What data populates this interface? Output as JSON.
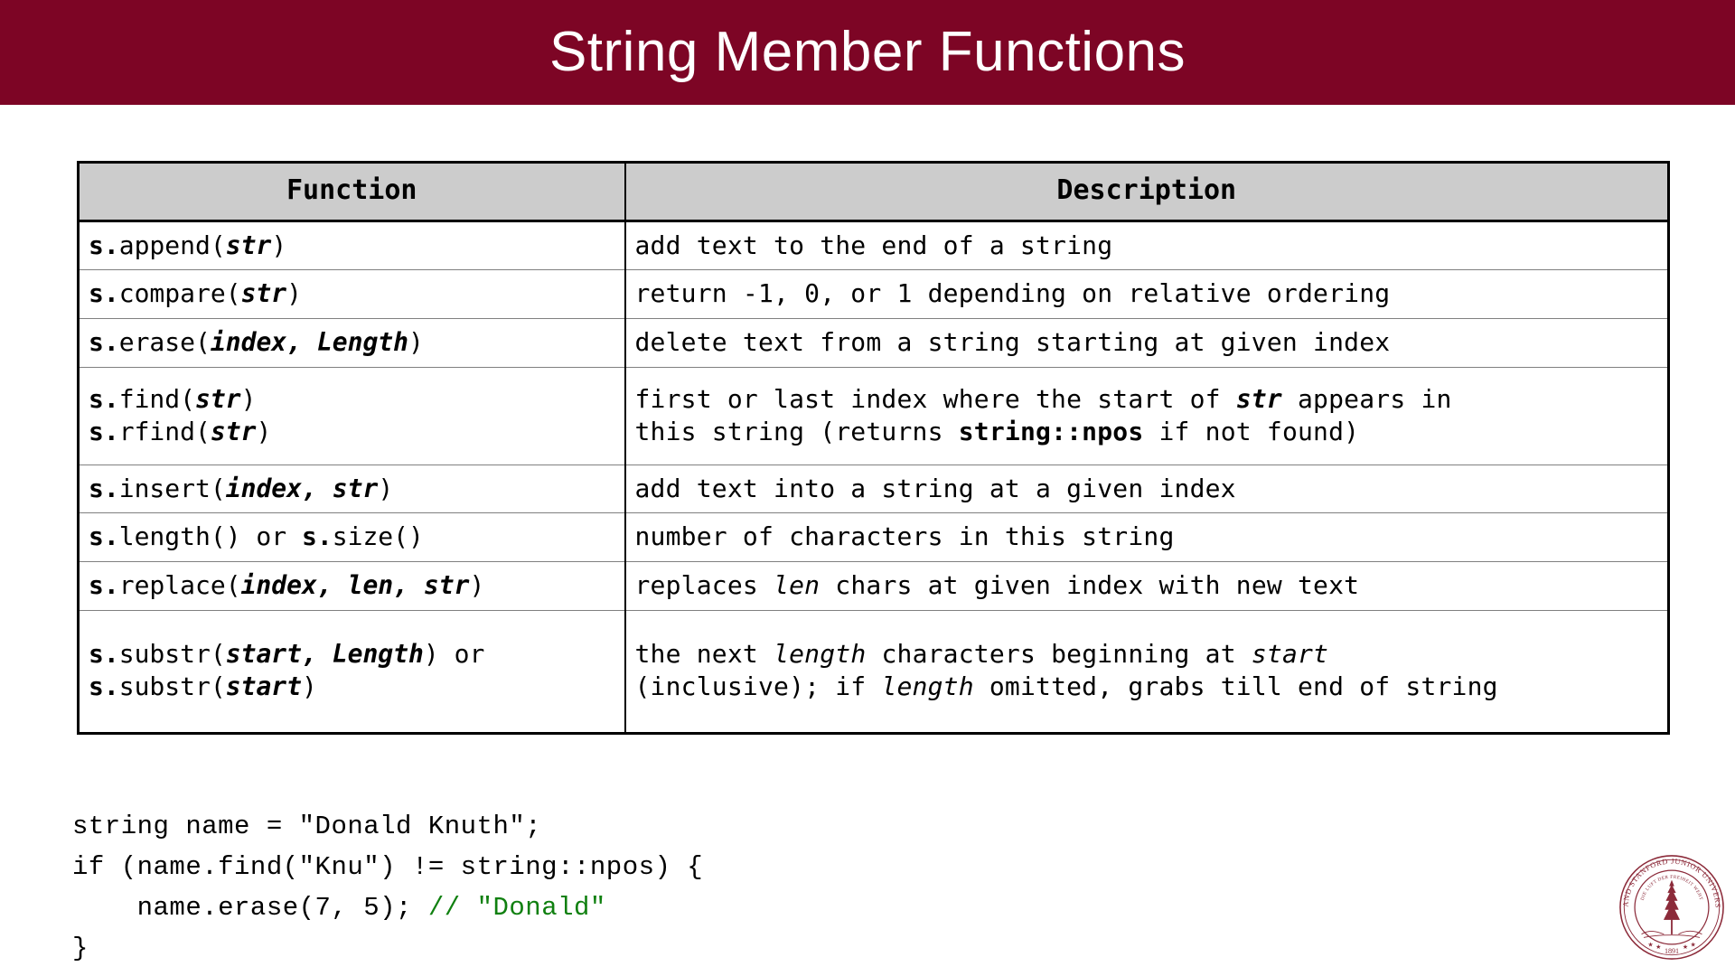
{
  "slide": {
    "title": "String Member Functions",
    "banner_color": "#7d0525",
    "header_cell_color": "#cccccc"
  },
  "table": {
    "headers": {
      "function": "Function",
      "description": "Description"
    },
    "rows": [
      {
        "function_plain": "s.append(str)",
        "function_parts": [
          {
            "t": "s.",
            "s": "b"
          },
          {
            "t": "append(",
            "s": ""
          },
          {
            "t": "str",
            "s": "bi"
          },
          {
            "t": ")",
            "s": ""
          }
        ],
        "description_plain": "add text to the end of a string",
        "description_parts": [
          {
            "t": "add text to the end of a string",
            "s": ""
          }
        ]
      },
      {
        "function_plain": "s.compare(str)",
        "function_parts": [
          {
            "t": "s.",
            "s": "b"
          },
          {
            "t": "compare(",
            "s": ""
          },
          {
            "t": "str",
            "s": "bi"
          },
          {
            "t": ")",
            "s": ""
          }
        ],
        "description_plain": "return -1, 0, or 1 depending on relative ordering",
        "description_parts": [
          {
            "t": "return -1, 0, or 1 depending on relative ordering",
            "s": ""
          }
        ]
      },
      {
        "function_plain": "s.erase(index, Length)",
        "function_parts": [
          {
            "t": "s.",
            "s": "b"
          },
          {
            "t": "erase(",
            "s": ""
          },
          {
            "t": "index, Length",
            "s": "bi"
          },
          {
            "t": ")",
            "s": ""
          }
        ],
        "description_plain": "delete text from a string starting at given index",
        "description_parts": [
          {
            "t": "delete text from a string starting at given index",
            "s": ""
          }
        ]
      },
      {
        "function_plain": "s.find(str)\ns.rfind(str)",
        "function_parts": [
          {
            "t": "s.",
            "s": "b"
          },
          {
            "t": "find(",
            "s": ""
          },
          {
            "t": "str",
            "s": "bi"
          },
          {
            "t": ")",
            "s": ""
          },
          {
            "t": "\n",
            "s": "br"
          },
          {
            "t": "s.",
            "s": "b"
          },
          {
            "t": "rfind(",
            "s": ""
          },
          {
            "t": "str",
            "s": "bi"
          },
          {
            "t": ")",
            "s": ""
          }
        ],
        "description_plain": "first or last index where the start of str appears in this string (returns string::npos if not found)",
        "description_parts": [
          {
            "t": "first or last index where the start of ",
            "s": ""
          },
          {
            "t": "str",
            "s": "bi"
          },
          {
            "t": " appears in",
            "s": ""
          },
          {
            "t": "\n",
            "s": "br"
          },
          {
            "t": "this string (returns ",
            "s": ""
          },
          {
            "t": "string::npos",
            "s": "b"
          },
          {
            "t": " if not found)",
            "s": ""
          }
        ]
      },
      {
        "function_plain": "s.insert(index, str)",
        "function_parts": [
          {
            "t": "s.",
            "s": "b"
          },
          {
            "t": "insert(",
            "s": ""
          },
          {
            "t": "index, str",
            "s": "bi"
          },
          {
            "t": ")",
            "s": ""
          }
        ],
        "description_plain": "add text into a string at a given index",
        "description_parts": [
          {
            "t": "add text into a string at a given index",
            "s": ""
          }
        ]
      },
      {
        "function_plain": "s.length() or s.size()",
        "function_parts": [
          {
            "t": "s.",
            "s": "b"
          },
          {
            "t": "length() or ",
            "s": ""
          },
          {
            "t": "s.",
            "s": "b"
          },
          {
            "t": "size()",
            "s": ""
          }
        ],
        "description_plain": "number of characters in this string",
        "description_parts": [
          {
            "t": "number of characters in this string",
            "s": ""
          }
        ]
      },
      {
        "function_plain": "s.replace(index, len, str)",
        "function_parts": [
          {
            "t": "s.",
            "s": "b"
          },
          {
            "t": "replace(",
            "s": ""
          },
          {
            "t": "index, len, str",
            "s": "bi"
          },
          {
            "t": ")",
            "s": ""
          }
        ],
        "description_plain": "replaces len chars at given index with new text",
        "description_parts": [
          {
            "t": "replaces ",
            "s": ""
          },
          {
            "t": "len",
            "s": "i"
          },
          {
            "t": " chars at given index with new text",
            "s": ""
          }
        ]
      },
      {
        "function_plain": "s.substr(start, Length) or\ns.substr(start)",
        "function_parts": [
          {
            "t": "s.",
            "s": "b"
          },
          {
            "t": "substr(",
            "s": ""
          },
          {
            "t": "start, Length",
            "s": "bi"
          },
          {
            "t": ") or",
            "s": ""
          },
          {
            "t": "\n",
            "s": "br"
          },
          {
            "t": "s.",
            "s": "b"
          },
          {
            "t": "substr(",
            "s": ""
          },
          {
            "t": "start",
            "s": "bi"
          },
          {
            "t": ")",
            "s": ""
          }
        ],
        "description_plain": "the next length characters beginning at start (inclusive); if length omitted, grabs till end of string",
        "description_parts": [
          {
            "t": "the next ",
            "s": ""
          },
          {
            "t": "length",
            "s": "i"
          },
          {
            "t": " characters beginning at ",
            "s": ""
          },
          {
            "t": "start",
            "s": "i"
          },
          {
            "t": "\n",
            "s": "br"
          },
          {
            "t": "(inclusive); if ",
            "s": ""
          },
          {
            "t": "length",
            "s": "i"
          },
          {
            "t": " omitted, grabs till end of string",
            "s": ""
          }
        ]
      }
    ]
  },
  "code_example": {
    "comment_color": "#108010",
    "lines": [
      [
        {
          "t": "string name = \"Donald Knuth\";",
          "s": ""
        }
      ],
      [
        {
          "t": "if (name.find(\"Knu\") != string::npos) {",
          "s": ""
        }
      ],
      [
        {
          "t": "    name.erase(7, 5); ",
          "s": ""
        },
        {
          "t": "// \"Donald\"",
          "s": "cmt"
        }
      ],
      [
        {
          "t": "}",
          "s": ""
        }
      ]
    ]
  },
  "seal": {
    "outer_text": "LELAND STANFORD JUNIOR UNIVERSITY",
    "motto": "DIE LUFT DER FREIHEIT WEHT",
    "year": "1891",
    "color": "#8c2b3a"
  }
}
